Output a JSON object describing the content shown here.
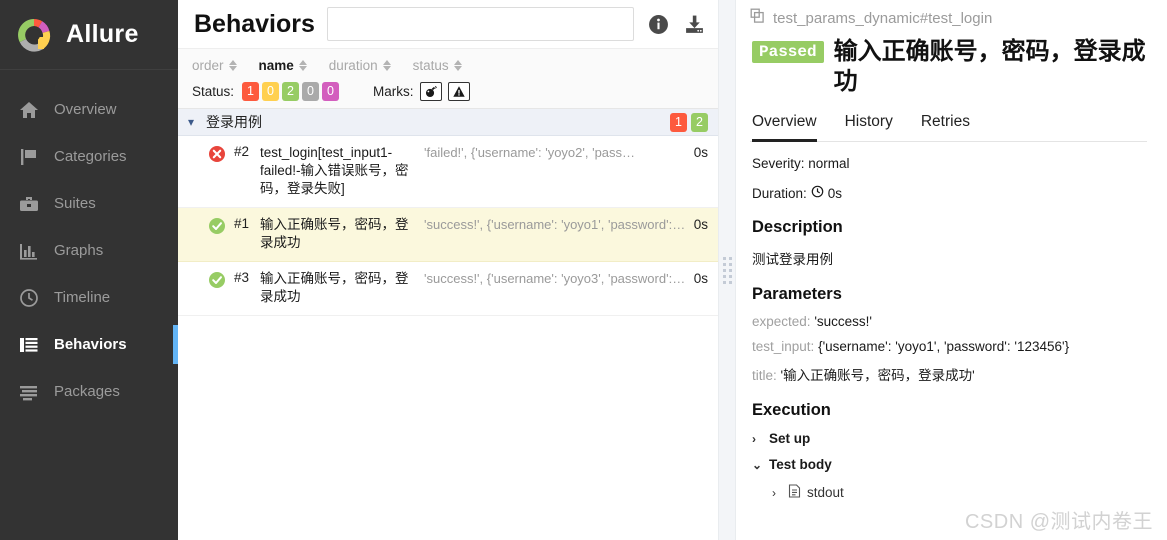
{
  "sidebar": {
    "brand": "Allure",
    "items": [
      {
        "label": "Overview",
        "icon": "home-icon",
        "active": false
      },
      {
        "label": "Categories",
        "icon": "flag-icon",
        "active": false
      },
      {
        "label": "Suites",
        "icon": "briefcase-icon",
        "active": false
      },
      {
        "label": "Graphs",
        "icon": "bar-chart-icon",
        "active": false
      },
      {
        "label": "Timeline",
        "icon": "clock-icon",
        "active": false
      },
      {
        "label": "Behaviors",
        "icon": "list-icon",
        "active": true
      },
      {
        "label": "Packages",
        "icon": "layers-icon",
        "active": false
      }
    ]
  },
  "middle": {
    "title": "Behaviors",
    "search": {
      "value": "",
      "placeholder": ""
    },
    "icons": {
      "info": "info-icon",
      "download": "download-icon"
    },
    "sort_columns": [
      {
        "label": "order",
        "active": false
      },
      {
        "label": "name",
        "active": true
      },
      {
        "label": "duration",
        "active": false
      },
      {
        "label": "status",
        "active": false
      }
    ],
    "status_filter": {
      "label": "Status:",
      "chips": [
        {
          "count": "1",
          "color": "#fd5a3e"
        },
        {
          "count": "0",
          "color": "#ffd050"
        },
        {
          "count": "2",
          "color": "#97cc64"
        },
        {
          "count": "0",
          "color": "#aaaaaa"
        },
        {
          "count": "0",
          "color": "#d35ebe"
        }
      ]
    },
    "marks_filter": {
      "label": "Marks:",
      "buttons": [
        {
          "icon": "bomb-icon"
        },
        {
          "icon": "warning-triangle-icon"
        }
      ]
    },
    "group": {
      "name": "登录用例",
      "expanded": true,
      "chips": [
        {
          "count": "1",
          "color": "#fd5a3e"
        },
        {
          "count": "2",
          "color": "#97cc64"
        }
      ]
    },
    "rows": [
      {
        "status": "failed",
        "order": "#2",
        "name": "test_login[test_input1-failed!-输入错误账号，密码，登录失败]",
        "description": "'failed!', {'username': 'yoyo2', 'pass…",
        "duration": "0s",
        "selected": false
      },
      {
        "status": "passed",
        "order": "#1",
        "name": "输入正确账号，密码，登录成功",
        "description": "'success!', {'username': 'yoyo1', 'password': '1…",
        "duration": "0s",
        "selected": true
      },
      {
        "status": "passed",
        "order": "#3",
        "name": "输入正确账号，密码，登录成功",
        "description": "'success!', {'username': 'yoyo3', 'password': '1…",
        "duration": "0s",
        "selected": false
      }
    ]
  },
  "detail": {
    "breadcrumb": "test_params_dynamic#test_login",
    "breadcrumb_icon": "copy-icon",
    "status_label": "Passed",
    "status_color": "#97cc64",
    "title": "输入正确账号，密码，登录成功",
    "tabs": [
      {
        "label": "Overview",
        "active": true
      },
      {
        "label": "History",
        "active": false
      },
      {
        "label": "Retries",
        "active": false
      }
    ],
    "severity": "Severity: normal",
    "duration_label": "Duration:",
    "duration_value": "0s",
    "description_heading": "Description",
    "description_text": "测试登录用例",
    "parameters_heading": "Parameters",
    "parameters": [
      {
        "key": "expected:",
        "value": "'success!'"
      },
      {
        "key": "test_input:",
        "value": "{'username': 'yoyo1', 'password': '123456'}"
      },
      {
        "key": "title:",
        "value": "'输入正确账号，密码，登录成功'"
      }
    ],
    "execution_heading": "Execution",
    "execution_rows": [
      {
        "label": "Set up",
        "expanded": false
      },
      {
        "label": "Test body",
        "expanded": true
      }
    ],
    "attachment": {
      "label": "stdout",
      "icon": "file-icon"
    }
  },
  "watermark": "CSDN @测试内卷王"
}
